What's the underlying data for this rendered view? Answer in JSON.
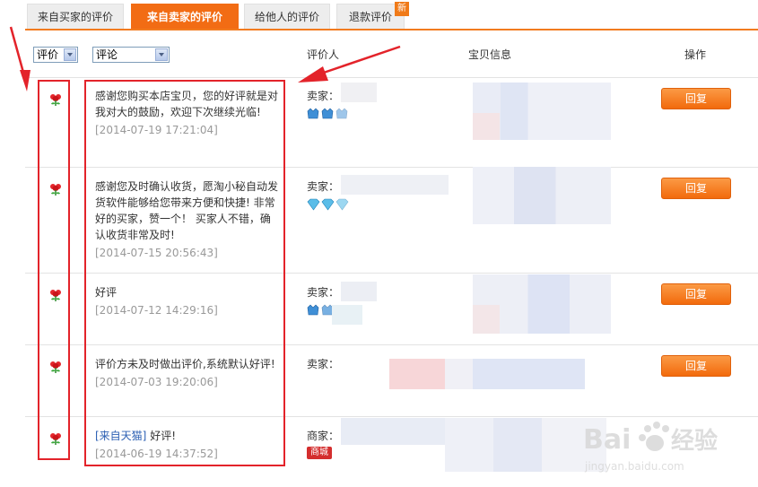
{
  "tabs": [
    {
      "label": "来自买家的评价",
      "active": false
    },
    {
      "label": "来自卖家的评价",
      "active": true
    },
    {
      "label": "给他人的评价",
      "active": false
    },
    {
      "label": "退款评价",
      "active": false
    }
  ],
  "new_badge": "新",
  "header": {
    "filter_rating_value": "评价",
    "filter_comment_value": "评论",
    "col_rater": "评价人",
    "col_item": "宝贝信息",
    "col_action": "操作"
  },
  "rows": [
    {
      "comment": "感谢您购买本店宝贝，您的好评就是对我对大的鼓励，欢迎下次继续光临!",
      "timestamp": "[2014-07-19 17:21:04]",
      "rater_label": "卖家：",
      "reply_label": "回复"
    },
    {
      "comment": "感谢您及时确认收货，愿淘小秘自动发货软件能够给您带来方便和快捷! 非常好的买家，赞一个！ 买家人不错，确认收货非常及时!",
      "timestamp": "[2014-07-15 20:56:43]",
      "rater_label": "卖家：",
      "reply_label": "回复"
    },
    {
      "comment": "好评",
      "timestamp": "[2014-07-12 14:29:16]",
      "rater_label": "卖家：",
      "reply_label": "回复"
    },
    {
      "comment": "评价方未及时做出评价,系统默认好评!",
      "timestamp": "[2014-07-03 19:20:06]",
      "rater_label": "卖家：",
      "reply_label": "回复"
    },
    {
      "comment_prefix": "[来自天猫]",
      "comment": " 好评!",
      "timestamp": "[2014-06-19 14:37:52]",
      "rater_label": "商家：",
      "badge": "商城"
    }
  ],
  "colors": {
    "accent": "#f26c14",
    "annotation": "#e3232a",
    "link": "#2b5fb3"
  }
}
